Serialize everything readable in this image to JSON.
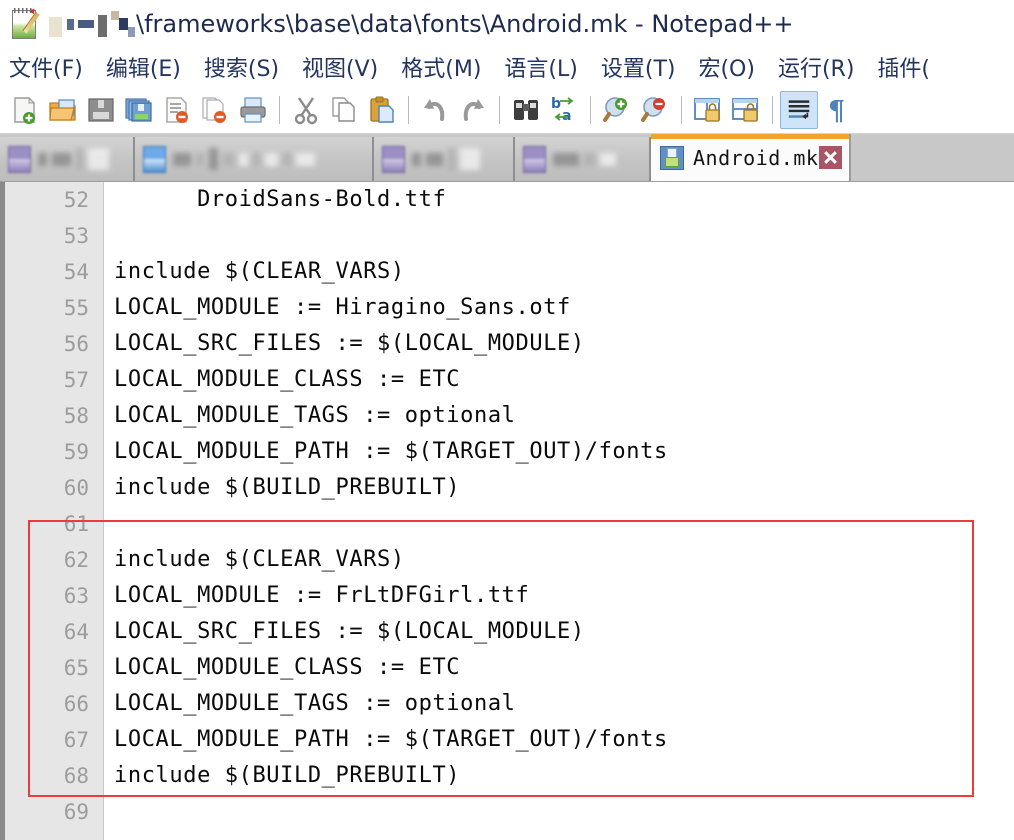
{
  "window": {
    "title_path_redacted": true,
    "title": "\\frameworks\\base\\data\\fonts\\Android.mk - Notepad++",
    "logo_icon": "notepad-plus-plus-icon"
  },
  "menubar": {
    "items": [
      {
        "label": "文件(F)",
        "name": "menu-file"
      },
      {
        "label": "编辑(E)",
        "name": "menu-edit"
      },
      {
        "label": "搜索(S)",
        "name": "menu-search"
      },
      {
        "label": "视图(V)",
        "name": "menu-view"
      },
      {
        "label": "格式(M)",
        "name": "menu-format"
      },
      {
        "label": "语言(L)",
        "name": "menu-language"
      },
      {
        "label": "设置(T)",
        "name": "menu-settings"
      },
      {
        "label": "宏(O)",
        "name": "menu-macro"
      },
      {
        "label": "运行(R)",
        "name": "menu-run"
      },
      {
        "label": "插件(",
        "name": "menu-plugins"
      }
    ]
  },
  "toolbar": {
    "buttons": [
      {
        "icon": "new-file-icon",
        "tooltip": "新建",
        "active": false
      },
      {
        "icon": "open-folder-icon",
        "tooltip": "打开",
        "active": false
      },
      {
        "icon": "save-icon",
        "tooltip": "保存",
        "active": false
      },
      {
        "icon": "save-all-icon",
        "tooltip": "全部保存",
        "active": false
      },
      {
        "icon": "close-file-icon",
        "tooltip": "关闭",
        "active": false
      },
      {
        "icon": "close-all-files-icon",
        "tooltip": "全部关闭",
        "active": false
      },
      {
        "icon": "print-icon",
        "tooltip": "打印",
        "active": false
      },
      {
        "icon": "cut-scissors-icon",
        "tooltip": "剪切",
        "active": false
      },
      {
        "icon": "copy-icon",
        "tooltip": "复制",
        "active": false
      },
      {
        "icon": "paste-clipboard-icon",
        "tooltip": "粘贴",
        "active": false
      },
      {
        "icon": "undo-arrow-icon",
        "tooltip": "撤销",
        "active": false
      },
      {
        "icon": "redo-arrow-icon",
        "tooltip": "恢复",
        "active": false
      },
      {
        "icon": "find-binoculars-icon",
        "tooltip": "查找",
        "active": false
      },
      {
        "icon": "replace-icon",
        "tooltip": "替换",
        "active": false
      },
      {
        "icon": "zoom-in-icon",
        "tooltip": "放大",
        "active": false
      },
      {
        "icon": "zoom-out-icon",
        "tooltip": "缩小",
        "active": false
      },
      {
        "icon": "sync-vertical-scroll-icon",
        "tooltip": "同步垂直滚动",
        "active": false
      },
      {
        "icon": "sync-horizontal-scroll-icon",
        "tooltip": "同步水平滚动",
        "active": false
      },
      {
        "icon": "word-wrap-icon",
        "tooltip": "自动换行",
        "active": true
      },
      {
        "icon": "show-all-characters-pilcrow-icon",
        "tooltip": "显示所有字符",
        "active": false
      }
    ]
  },
  "tabs": {
    "items": [
      {
        "label": "",
        "redacted": true,
        "active": false,
        "name": "tab-redacted-1"
      },
      {
        "label": "",
        "redacted": true,
        "active": false,
        "name": "tab-redacted-2"
      },
      {
        "label": "",
        "redacted": true,
        "active": false,
        "name": "tab-redacted-3"
      },
      {
        "label": "",
        "redacted": true,
        "active": false,
        "name": "tab-redacted-4"
      }
    ],
    "active_tab": {
      "label": "Android.mk",
      "icon": "save-floppy-icon",
      "close_icon": "close-x-icon",
      "modified": false
    }
  },
  "editor": {
    "first_visible_line": 52,
    "lines": [
      {
        "no": "52",
        "text": "      DroidSans-Bold.ttf"
      },
      {
        "no": "53",
        "text": ""
      },
      {
        "no": "54",
        "text": "include $(CLEAR_VARS)"
      },
      {
        "no": "55",
        "text": "LOCAL_MODULE := Hiragino_Sans.otf"
      },
      {
        "no": "56",
        "text": "LOCAL_SRC_FILES := $(LOCAL_MODULE)"
      },
      {
        "no": "57",
        "text": "LOCAL_MODULE_CLASS := ETC"
      },
      {
        "no": "58",
        "text": "LOCAL_MODULE_TAGS := optional"
      },
      {
        "no": "59",
        "text": "LOCAL_MODULE_PATH := $(TARGET_OUT)/fonts"
      },
      {
        "no": "60",
        "text": "include $(BUILD_PREBUILT)"
      },
      {
        "no": "61",
        "text": ""
      },
      {
        "no": "62",
        "text": "include $(CLEAR_VARS)"
      },
      {
        "no": "63",
        "text": "LOCAL_MODULE := FrLtDFGirl.ttf"
      },
      {
        "no": "64",
        "text": "LOCAL_SRC_FILES := $(LOCAL_MODULE)"
      },
      {
        "no": "65",
        "text": "LOCAL_MODULE_CLASS := ETC"
      },
      {
        "no": "66",
        "text": "LOCAL_MODULE_TAGS := optional"
      },
      {
        "no": "67",
        "text": "LOCAL_MODULE_PATH := $(TARGET_OUT)/fonts"
      },
      {
        "no": "68",
        "text": "include $(BUILD_PREBUILT)"
      },
      {
        "no": "69",
        "text": ""
      }
    ],
    "annotation": {
      "type": "rectangle",
      "color": "#ee3a3a",
      "covers_lines": "61-68"
    }
  },
  "colors": {
    "title_text": "#1d2a4d",
    "menu_text": "#23355e",
    "tab_active_accent": "#f3a22a",
    "tabbar_bg": "#c8c8c8",
    "gutter_bg": "#e6e6e6",
    "lineno_text": "#9c9c9c",
    "code_text": "#0a0a0a",
    "annotation_red": "#ee3a3a",
    "toolbar_active_bg": "#cfe4f8"
  }
}
